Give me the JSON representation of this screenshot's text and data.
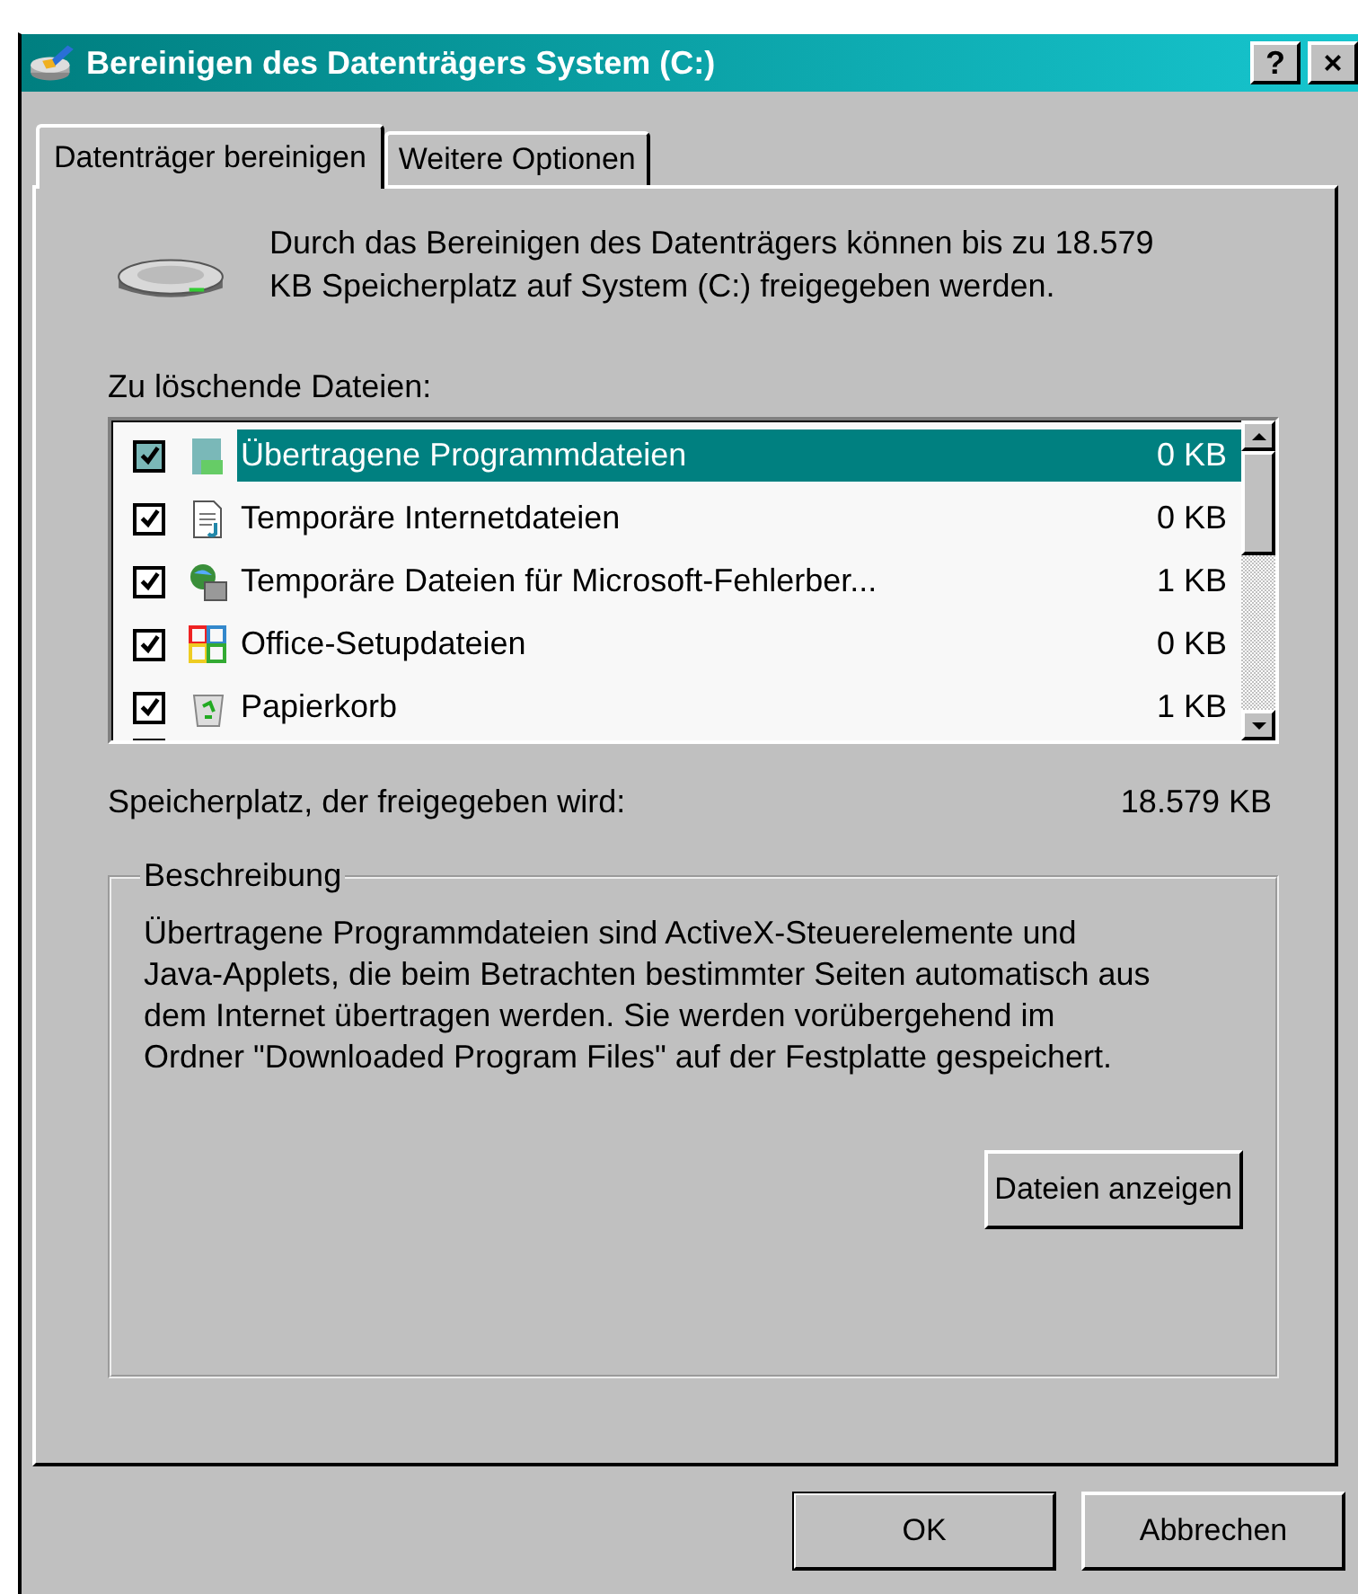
{
  "window": {
    "title": "Bereinigen des Datenträgers System (C:)",
    "title_buttons": [
      "?",
      "×"
    ]
  },
  "tabs": [
    {
      "label": "Datenträger bereinigen",
      "selected": true
    },
    {
      "label": "Weitere Optionen",
      "selected": false
    }
  ],
  "intro": "Durch das Bereinigen des Datenträgers können bis zu 18.579 KB Speicherplatz auf System (C:) freigegeben werden.",
  "files_label": "Zu löschende Dateien:",
  "files": [
    {
      "name": "Übertragene Programmdateien",
      "size": "0 KB",
      "checked": true,
      "selected": true,
      "kind": "package"
    },
    {
      "name": "Temporäre Internetdateien",
      "size": "0 KB",
      "checked": true,
      "selected": false,
      "kind": "document"
    },
    {
      "name": "Temporäre Dateien für Microsoft-Fehlerber...",
      "size": "1 KB",
      "checked": true,
      "selected": false,
      "kind": "globe"
    },
    {
      "name": "Office-Setupdateien",
      "size": "0 KB",
      "checked": true,
      "selected": false,
      "kind": "office"
    },
    {
      "name": "Papierkorb",
      "size": "1 KB",
      "checked": true,
      "selected": false,
      "kind": "bin"
    }
  ],
  "space_label": "Speicherplatz, der freigegeben wird:",
  "space_value": "18.579 KB",
  "description": {
    "title": "Beschreibung",
    "text": "Übertragene Programmdateien sind ActiveX-Steuerelemente und Java-Applets, die beim Betrachten bestimmter Seiten automatisch aus dem Internet übertragen werden. Sie werden vorübergehend im Ordner \"Downloaded Program Files\" auf der Festplatte gespeichert.",
    "button": "Dateien anzeigen"
  },
  "buttons": [
    "OK",
    "Abbrechen"
  ]
}
